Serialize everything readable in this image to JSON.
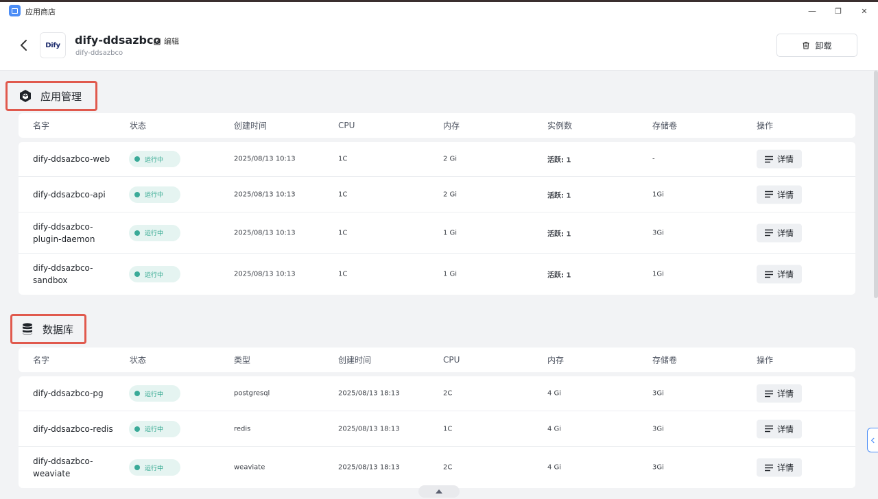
{
  "window": {
    "title": "应用商店",
    "minimize": "—",
    "restore": "❐",
    "close": "✕"
  },
  "header": {
    "logo_text": "Dify",
    "app_name": "dify-ddsazbco",
    "edit_label": "编辑",
    "subtitle": "dify-ddsazbco",
    "uninstall_label": "卸载"
  },
  "app_management": {
    "title": "应用管理",
    "icon": "hexagon-icon",
    "columns": [
      "名字",
      "状态",
      "创建时间",
      "CPU",
      "内存",
      "实例数",
      "存储卷",
      "操作"
    ],
    "rows": [
      {
        "name": "dify-ddsazbco-web",
        "status": "运行中",
        "created": "2025/08/13 10:13",
        "cpu": "1C",
        "memory": "2 Gi",
        "instances": "活跃: 1",
        "storage": "-",
        "action": "详情"
      },
      {
        "name": "dify-ddsazbco-api",
        "status": "运行中",
        "created": "2025/08/13 10:13",
        "cpu": "1C",
        "memory": "2 Gi",
        "instances": "活跃: 1",
        "storage": "1Gi",
        "action": "详情"
      },
      {
        "name": "dify-ddsazbco-plugin-daemon",
        "status": "运行中",
        "created": "2025/08/13 10:13",
        "cpu": "1C",
        "memory": "1 Gi",
        "instances": "活跃: 1",
        "storage": "3Gi",
        "action": "详情"
      },
      {
        "name": "dify-ddsazbco-sandbox",
        "status": "运行中",
        "created": "2025/08/13 10:13",
        "cpu": "1C",
        "memory": "1 Gi",
        "instances": "活跃: 1",
        "storage": "1Gi",
        "action": "详情"
      }
    ]
  },
  "database": {
    "title": "数据库",
    "icon": "database-icon",
    "columns": [
      "名字",
      "状态",
      "类型",
      "创建时间",
      "CPU",
      "内存",
      "存储卷",
      "操作"
    ],
    "rows": [
      {
        "name": "dify-ddsazbco-pg",
        "status": "运行中",
        "type": "postgresql",
        "created": "2025/08/13 18:13",
        "cpu": "2C",
        "memory": "4 Gi",
        "storage": "3Gi",
        "action": "详情"
      },
      {
        "name": "dify-ddsazbco-redis",
        "status": "运行中",
        "type": "redis",
        "created": "2025/08/13 18:13",
        "cpu": "1C",
        "memory": "4 Gi",
        "storage": "3Gi",
        "action": "详情"
      },
      {
        "name": "dify-ddsazbco-weaviate",
        "status": "运行中",
        "type": "weaviate",
        "created": "2025/08/13 18:13",
        "cpu": "2C",
        "memory": "4 Gi",
        "storage": "3Gi",
        "action": "详情"
      }
    ]
  },
  "colors": {
    "accent": "#4c8df6",
    "status_green": "#2ba58c",
    "highlight_border": "#e0594d"
  }
}
